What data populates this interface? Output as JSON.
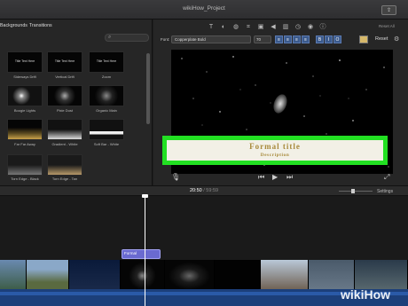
{
  "window": {
    "title": "wikiHow_Project"
  },
  "browser": {
    "tabs": [
      "Backgrounds",
      "Transitions"
    ],
    "search_icon": "search-icon",
    "titles": [
      {
        "label": "Sideways Drift",
        "preview": "Title Text Here"
      },
      {
        "label": "Vertical Drift",
        "preview": "Title Text Here"
      },
      {
        "label": "Zoom",
        "preview": "Title Text Here"
      },
      {
        "label": "Boogie Lights",
        "preview": ""
      },
      {
        "label": "Pixie Dust",
        "preview": ""
      },
      {
        "label": "Organic Main",
        "preview": ""
      },
      {
        "label": "Far Far Away",
        "preview": ""
      },
      {
        "label": "Gradient - White",
        "preview": ""
      },
      {
        "label": "Soft Bar - White",
        "preview": ""
      },
      {
        "label": "Torn Edge - Black",
        "preview": ""
      },
      {
        "label": "Torn Edge - Tan",
        "preview": ""
      }
    ]
  },
  "viewer": {
    "reset_all": "Reset All",
    "font_label": "Font:",
    "font_value": "Copperplate Bold",
    "size_value": "70",
    "reset_label": "Reset",
    "format_buttons": [
      "≡",
      "≡",
      "≡",
      "≡",
      "B",
      "I",
      "O"
    ],
    "title_line1": "Formal title",
    "title_line2": "Description",
    "accent_color": "#22e022",
    "text_color": "#a88a3c"
  },
  "timeline": {
    "current_time": "20:50",
    "separator": " / ",
    "total_time": "59:59",
    "settings_label": "Settings",
    "title_clip_label": "Formal"
  },
  "watermark": {
    "wiki": "wiki",
    "how": "How"
  }
}
